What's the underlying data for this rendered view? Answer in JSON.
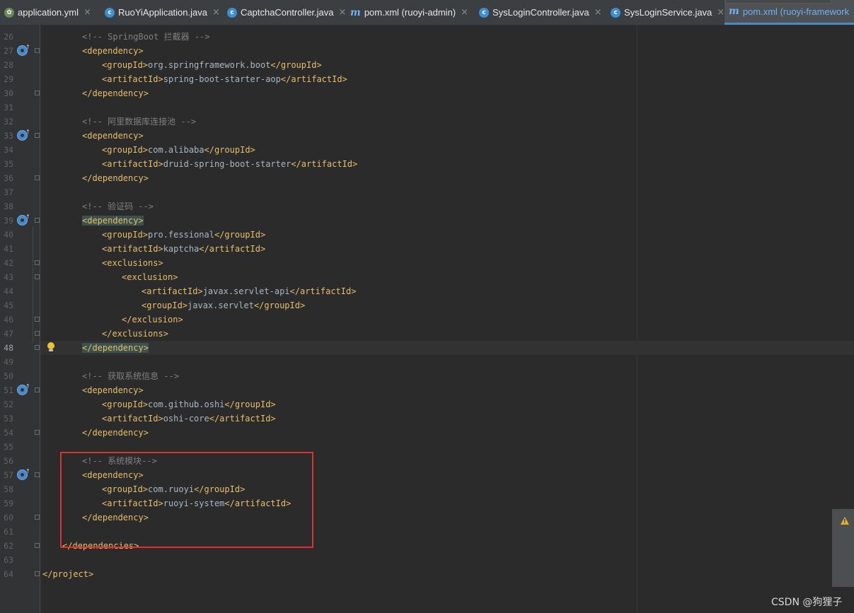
{
  "tabs": [
    {
      "label": "application.yml",
      "icon": "spring-leaf-icon",
      "active": false
    },
    {
      "label": "RuoYiApplication.java",
      "icon": "class-c-icon",
      "active": false
    },
    {
      "label": "CaptchaController.java",
      "icon": "class-c-icon",
      "active": false
    },
    {
      "label": "pom.xml (ruoyi-admin)",
      "icon": "maven-m-icon",
      "active": false
    },
    {
      "label": "SysLoginController.java",
      "icon": "class-c-icon",
      "active": false
    },
    {
      "label": "SysLoginService.java",
      "icon": "class-c-icon",
      "active": false
    },
    {
      "label": "pom.xml (ruoyi-framework",
      "icon": "maven-m-icon",
      "active": true
    }
  ],
  "tab_close_glyph": "×",
  "lines": [
    {
      "n": "26",
      "ind": 2,
      "segs": [
        [
          "cm",
          "<!-- SpringBoot 拦截器 -->"
        ]
      ]
    },
    {
      "n": "27",
      "ind": 2,
      "segs": [
        [
          "tag",
          "<dependency>"
        ]
      ],
      "gicon": true,
      "fold": true
    },
    {
      "n": "28",
      "ind": 3,
      "segs": [
        [
          "tag",
          "<groupId>"
        ],
        [
          "tx",
          "org.springframework.boot"
        ],
        [
          "tag",
          "</groupId>"
        ]
      ]
    },
    {
      "n": "29",
      "ind": 3,
      "segs": [
        [
          "tag",
          "<artifactId>"
        ],
        [
          "tx",
          "spring-boot-starter-aop"
        ],
        [
          "tag",
          "</artifactId>"
        ]
      ]
    },
    {
      "n": "30",
      "ind": 2,
      "segs": [
        [
          "tag",
          "</dependency>"
        ]
      ],
      "fold": true
    },
    {
      "n": "31",
      "ind": 0,
      "segs": []
    },
    {
      "n": "32",
      "ind": 2,
      "segs": [
        [
          "cm",
          "<!-- 阿里数据库连接池 -->"
        ]
      ]
    },
    {
      "n": "33",
      "ind": 2,
      "segs": [
        [
          "tag",
          "<dependency>"
        ]
      ],
      "gicon": true,
      "fold": true
    },
    {
      "n": "34",
      "ind": 3,
      "segs": [
        [
          "tag",
          "<groupId>"
        ],
        [
          "tx",
          "com.alibaba"
        ],
        [
          "tag",
          "</groupId>"
        ]
      ]
    },
    {
      "n": "35",
      "ind": 3,
      "segs": [
        [
          "tag",
          "<artifactId>"
        ],
        [
          "tx",
          "druid-spring-boot-starter"
        ],
        [
          "tag",
          "</artifactId>"
        ]
      ]
    },
    {
      "n": "36",
      "ind": 2,
      "segs": [
        [
          "tag",
          "</dependency>"
        ]
      ],
      "fold": true
    },
    {
      "n": "37",
      "ind": 0,
      "segs": []
    },
    {
      "n": "38",
      "ind": 2,
      "segs": [
        [
          "cm",
          "<!-- 验证码 -->"
        ]
      ]
    },
    {
      "n": "39",
      "ind": 2,
      "segs": [
        [
          "tag",
          "<dependency>",
          "hl"
        ]
      ],
      "gicon": true,
      "fold": true
    },
    {
      "n": "40",
      "ind": 3,
      "segs": [
        [
          "tag",
          "<groupId>"
        ],
        [
          "tx",
          "pro.fessional"
        ],
        [
          "tag",
          "</groupId>"
        ]
      ]
    },
    {
      "n": "41",
      "ind": 3,
      "segs": [
        [
          "tag",
          "<artifactId>"
        ],
        [
          "tx",
          "kaptcha"
        ],
        [
          "tag",
          "</artifactId>"
        ]
      ]
    },
    {
      "n": "42",
      "ind": 3,
      "segs": [
        [
          "tag",
          "<exclusions>"
        ]
      ],
      "fold": true
    },
    {
      "n": "43",
      "ind": 4,
      "segs": [
        [
          "tag",
          "<exclusion>"
        ]
      ],
      "fold": true
    },
    {
      "n": "44",
      "ind": 5,
      "segs": [
        [
          "tag",
          "<artifactId>"
        ],
        [
          "tx",
          "javax.servlet-api"
        ],
        [
          "tag",
          "</artifactId>"
        ]
      ]
    },
    {
      "n": "45",
      "ind": 5,
      "segs": [
        [
          "tag",
          "<groupId>"
        ],
        [
          "tx",
          "javax.servlet"
        ],
        [
          "tag",
          "</groupId>"
        ]
      ]
    },
    {
      "n": "46",
      "ind": 4,
      "segs": [
        [
          "tag",
          "</exclusion>"
        ]
      ],
      "fold": true
    },
    {
      "n": "47",
      "ind": 3,
      "segs": [
        [
          "tag",
          "</exclusions>"
        ]
      ],
      "fold": true
    },
    {
      "n": "48",
      "ind": 2,
      "segs": [
        [
          "tag",
          "</dependency>",
          "hl"
        ]
      ],
      "fold": true,
      "bulb": true,
      "current": true
    },
    {
      "n": "49",
      "ind": 0,
      "segs": []
    },
    {
      "n": "50",
      "ind": 2,
      "segs": [
        [
          "cm",
          "<!-- 获取系统信息 -->"
        ]
      ]
    },
    {
      "n": "51",
      "ind": 2,
      "segs": [
        [
          "tag",
          "<dependency>"
        ]
      ],
      "gicon": true,
      "fold": true
    },
    {
      "n": "52",
      "ind": 3,
      "segs": [
        [
          "tag",
          "<groupId>"
        ],
        [
          "tx",
          "com.github.oshi"
        ],
        [
          "tag",
          "</groupId>"
        ]
      ]
    },
    {
      "n": "53",
      "ind": 3,
      "segs": [
        [
          "tag",
          "<artifactId>"
        ],
        [
          "tx",
          "oshi-core"
        ],
        [
          "tag",
          "</artifactId>"
        ]
      ]
    },
    {
      "n": "54",
      "ind": 2,
      "segs": [
        [
          "tag",
          "</dependency>"
        ]
      ],
      "fold": true
    },
    {
      "n": "55",
      "ind": 0,
      "segs": []
    },
    {
      "n": "56",
      "ind": 2,
      "segs": [
        [
          "cm",
          "<!-- 系统模块-->"
        ]
      ]
    },
    {
      "n": "57",
      "ind": 2,
      "segs": [
        [
          "tag",
          "<dependency>"
        ]
      ],
      "gicon": true,
      "fold": true
    },
    {
      "n": "58",
      "ind": 3,
      "segs": [
        [
          "tag",
          "<groupId>"
        ],
        [
          "tx",
          "com.ruoyi"
        ],
        [
          "tag",
          "</groupId>"
        ]
      ]
    },
    {
      "n": "59",
      "ind": 3,
      "segs": [
        [
          "tag",
          "<artifactId>"
        ],
        [
          "tx",
          "ruoyi-system"
        ],
        [
          "tag",
          "</artifactId>"
        ]
      ]
    },
    {
      "n": "60",
      "ind": 2,
      "segs": [
        [
          "tag",
          "</dependency>"
        ]
      ],
      "fold": true
    },
    {
      "n": "61",
      "ind": 0,
      "segs": []
    },
    {
      "n": "62",
      "ind": 1,
      "segs": [
        [
          "tag",
          "</dependencies>"
        ]
      ],
      "fold": true
    },
    {
      "n": "63",
      "ind": 0,
      "segs": []
    },
    {
      "n": "64",
      "ind": 0,
      "segs": [
        [
          "tag",
          "</project>"
        ]
      ],
      "fold": true
    }
  ],
  "watermark": "CSDN @狗狸子",
  "colors": {
    "tag": "#e8bf6a",
    "comment": "#808080",
    "text": "#a9b7c6",
    "annotation_box": "#e0312f",
    "active_tab": "#6fb1f5"
  }
}
